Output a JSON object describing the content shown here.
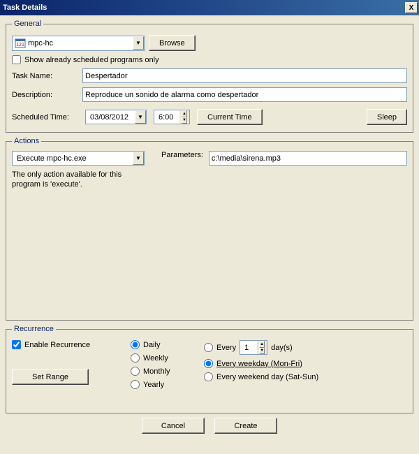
{
  "window": {
    "title": "Task Details",
    "close_x": "X"
  },
  "general": {
    "legend": "General",
    "program_icon_text": "121",
    "program_name": "mpc-hc",
    "browse_label": "Browse",
    "show_scheduled_label": "Show already scheduled programs only",
    "task_name_label": "Task Name:",
    "task_name_value": "Despertador",
    "description_label": "Description:",
    "description_value": "Reproduce un sonido de alarma como despertador",
    "scheduled_time_label": "Scheduled Time:",
    "date_value": "03/08/2012",
    "time_value": "6:00",
    "current_time_label": "Current Time",
    "sleep_label": "Sleep"
  },
  "actions": {
    "legend": "Actions",
    "action_value": "Execute mpc-hc.exe",
    "note": "The only action available for this program is 'execute'.",
    "parameters_label": "Parameters:",
    "parameters_value": "c:\\media\\sirena.mp3"
  },
  "recurrence": {
    "legend": "Recurrence",
    "enable_label": "Enable Recurrence",
    "set_range_label": "Set Range",
    "freq": {
      "daily": "Daily",
      "weekly": "Weekly",
      "monthly": "Monthly",
      "yearly": "Yearly"
    },
    "every_label": "Every",
    "every_value": "1",
    "days_label": "day(s)",
    "every_weekday_label": "Every weekday (Mon-Fri)",
    "every_weekend_label": "Every weekend day (Sat-Sun)"
  },
  "buttons": {
    "cancel": "Cancel",
    "create": "Create"
  },
  "glyphs": {
    "down": "▼",
    "up": "▲"
  }
}
